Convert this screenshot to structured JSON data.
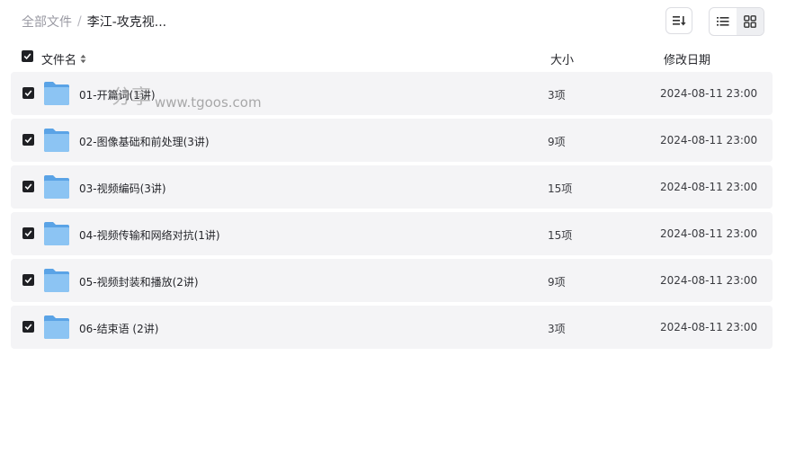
{
  "breadcrumb": {
    "root": "全部文件",
    "separator": "/",
    "current": "李江-攻克视..."
  },
  "toolbar": {
    "sort_icon": "sort-icon",
    "list_view_icon": "list-view-icon",
    "grid_view_icon": "grid-view-icon",
    "active_view": "grid"
  },
  "table": {
    "headers": {
      "name": "文件名",
      "size": "大小",
      "date": "修改日期"
    },
    "rows": [
      {
        "name": "01-开篇词(1讲)",
        "count": "3项",
        "date": "2024-08-11 23:00"
      },
      {
        "name": "02-图像基础和前处理(3讲)",
        "count": "9项",
        "date": "2024-08-11 23:00"
      },
      {
        "name": "03-视频编码(3讲)",
        "count": "15项",
        "date": "2024-08-11 23:00"
      },
      {
        "name": "04-视频传输和网络对抗(1讲)",
        "count": "15项",
        "date": "2024-08-11 23:00"
      },
      {
        "name": "05-视频封装和播放(2讲)",
        "count": "9项",
        "date": "2024-08-11 23:00"
      },
      {
        "name": "06-结束语 (2讲)",
        "count": "3项",
        "date": "2024-08-11 23:00"
      }
    ]
  },
  "watermark": {
    "text": "分享",
    "url": "www.tgoos.com"
  },
  "colors": {
    "row_bg": "#f4f4f6",
    "folder": "#6fb1ea",
    "checkbox": "#1f2024"
  }
}
